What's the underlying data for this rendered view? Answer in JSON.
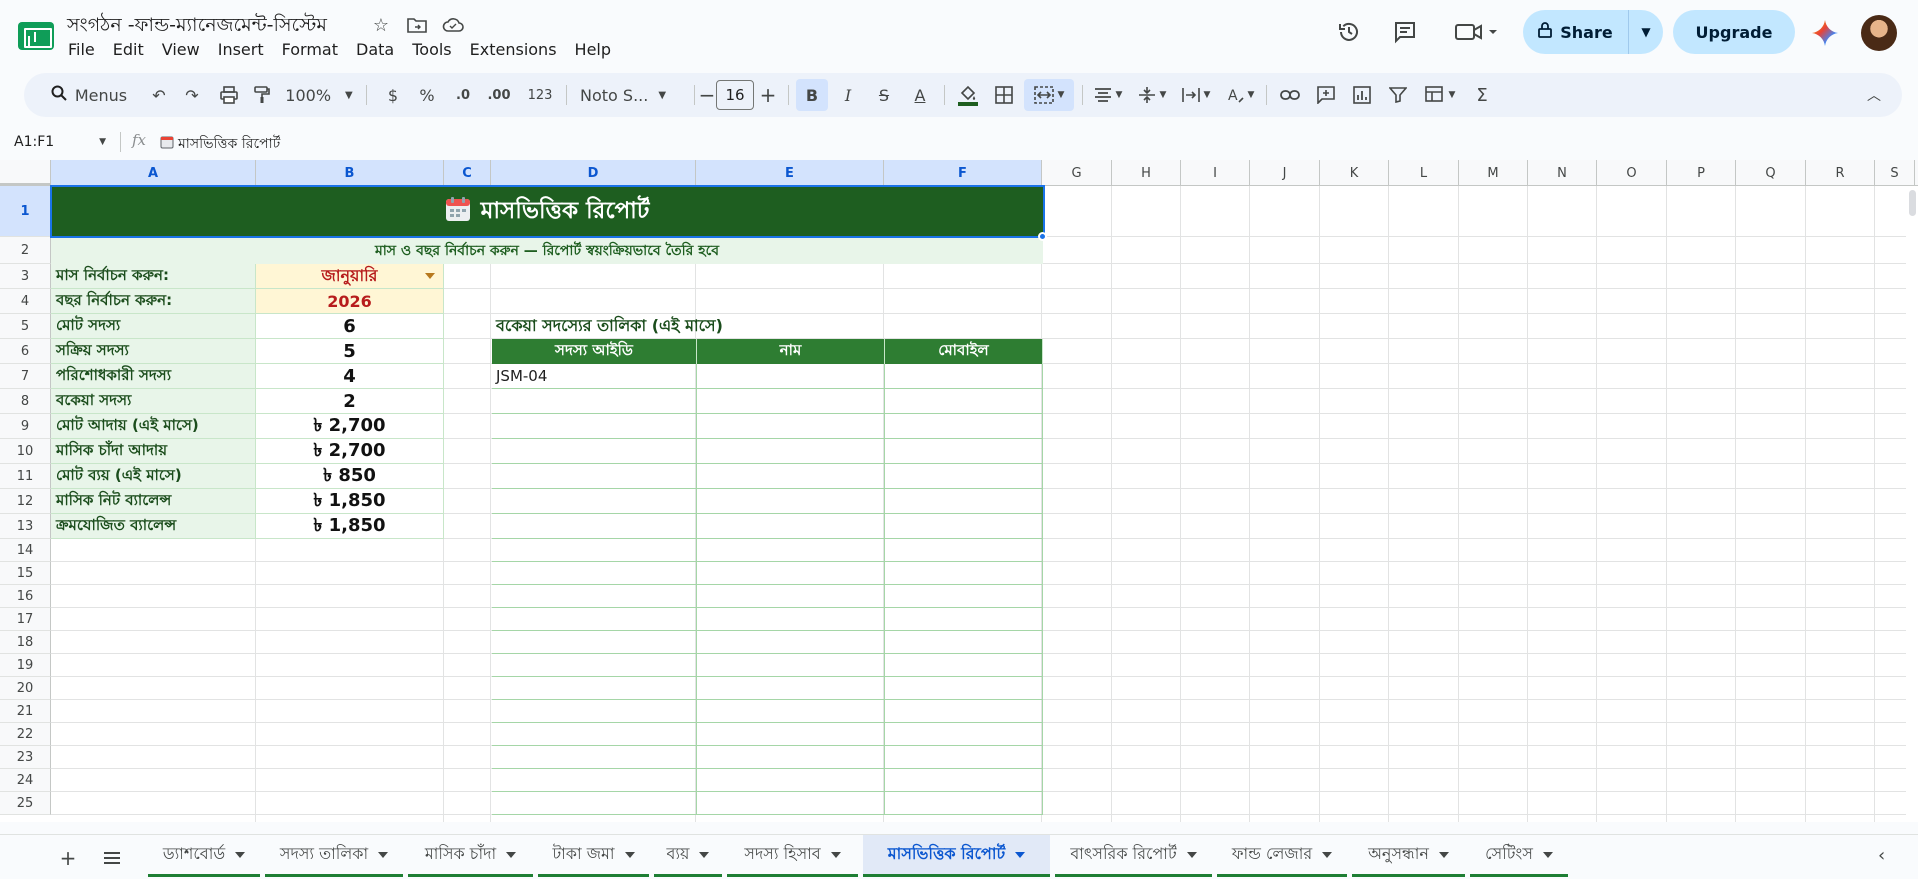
{
  "app": {
    "doc_title": "সংগঠন -ফান্ড-ম্যানেজমেন্ট-সিস্টেম",
    "menu": [
      "File",
      "Edit",
      "View",
      "Insert",
      "Format",
      "Data",
      "Tools",
      "Extensions",
      "Help"
    ],
    "share_label": "Share",
    "upgrade_label": "Upgrade"
  },
  "toolbar": {
    "search_label": "Menus",
    "zoom": "100%",
    "currency": "$",
    "percent": "%",
    "decrease_decimal": ".0",
    "increase_decimal": ".00",
    "number_format": "123",
    "font_family": "Noto S...",
    "font_size": "16"
  },
  "formula_bar": {
    "name_box": "A1:F1",
    "fx": "fx",
    "content": "মাসভিত্তিক রিপোর্ট"
  },
  "grid": {
    "columns": [
      "A",
      "B",
      "C",
      "D",
      "E",
      "F",
      "G",
      "H",
      "I",
      "J",
      "K",
      "L",
      "M",
      "N",
      "O",
      "P",
      "Q",
      "R",
      "S"
    ],
    "rows": [
      "1",
      "2",
      "3",
      "4",
      "5",
      "6",
      "7",
      "8",
      "9",
      "10",
      "11",
      "12",
      "13",
      "14",
      "15",
      "16",
      "17",
      "18",
      "19",
      "20",
      "21",
      "22",
      "23",
      "24",
      "25"
    ]
  },
  "report": {
    "title": "মাসভিত্তিক রিপোর্ট",
    "subtitle": "মাস ও বছর নির্বাচন করুন — রিপোর্ট স্বয়ংক্রিয়ভাবে তৈরি হবে",
    "month_label": "মাস নির্বাচন করুন:",
    "month_value": "জানুয়ারি",
    "year_label": "বছর নির্বাচন করুন:",
    "year_value": "2026",
    "stats": [
      {
        "label": "মোট সদস্য",
        "value": "6"
      },
      {
        "label": "সক্রিয় সদস্য",
        "value": "5"
      },
      {
        "label": "পরিশোধকারী সদস্য",
        "value": "4"
      },
      {
        "label": "বকেয়া সদস্য",
        "value": "2"
      },
      {
        "label": "মোট আদায় (এই মাসে)",
        "value": "৳ 2,700"
      },
      {
        "label": "মাসিক চাঁদা আদায়",
        "value": "৳ 2,700"
      },
      {
        "label": "মোট ব্যয় (এই মাসে)",
        "value": "৳ 850"
      },
      {
        "label": "মাসিক নিট ব্যালেন্স",
        "value": "৳ 1,850"
      },
      {
        "label": "ক্রমযোজিত ব্যালেন্স",
        "value": "৳ 1,850"
      }
    ],
    "due_title": "বকেয়া সদস্যের তালিকা (এই মাসে)",
    "due_headers": [
      "সদস্য আইডি",
      "নাম",
      "মোবাইল"
    ],
    "due_rows": [
      [
        "JSM-04",
        "",
        ""
      ]
    ]
  },
  "sheets": {
    "tabs": [
      "ড্যাশবোর্ড",
      "সদস্য তালিকা",
      "মাসিক চাঁদা",
      "টাকা জমা",
      "ব্যয়",
      "সদস্য হিসাব",
      "মাসভিত্তিক রিপোর্ট",
      "বাৎসরিক রিপোর্ট",
      "ফান্ড লেজার",
      "অনুসন্ধান",
      "সেটিংস"
    ],
    "active_index": 6
  },
  "colors": {
    "banner_green": "#1e5e20",
    "header_green": "#2e7d32",
    "label_bg": "#e8f5e9",
    "select_bg": "#fff6d5",
    "select_text": "#b71c1c",
    "accent_blue": "#1a73e8"
  }
}
